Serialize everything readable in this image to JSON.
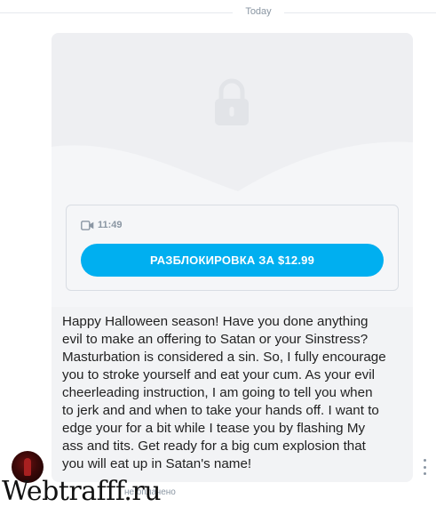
{
  "date_divider": {
    "label": "Today"
  },
  "message": {
    "media": {
      "locked": true,
      "lock_icon": "lock-icon",
      "duration_icon": "video-camera-icon",
      "duration": "11:49",
      "unlock_button_label": "РАЗБЛОКИРОВКА ЗА $12.99"
    },
    "text": "Happy Halloween season! Have you done anything\nevil to make an offering to Satan or your Sinstress?\nMasturbation is considered a sin. So, I fully encourage\nyou to stroke yourself and eat your cum. As your evil\ncheerleading instruction, I am going to tell you when\nto jerk and and when to take your hands off. I want to\nedge your for a bit while I tease you by flashing My\nass and tits. Get ready for a big cum explosion that\nyou will eat up in Satan's name!",
    "status": "не оплачено",
    "menu_icon": "more-vertical-icon"
  },
  "watermark": "Webtrafff.ru",
  "colors": {
    "accent": "#00aff0",
    "bubble_bg": "#f2f3f5",
    "muted_text": "#8a96a3"
  }
}
